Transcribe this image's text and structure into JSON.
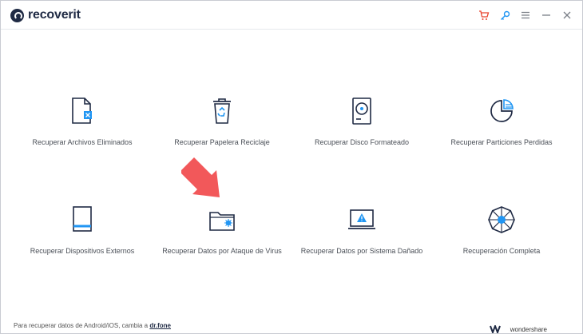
{
  "app": {
    "name_prefix": "recover",
    "name_suffix": "it"
  },
  "titlebar": {
    "icons": [
      "cart-icon",
      "key-icon",
      "menu-icon",
      "minimize-icon",
      "close-icon"
    ],
    "accent_colors": {
      "cart": "#e8432e",
      "key": "#2196f3",
      "neutral": "#7a7f87"
    }
  },
  "options": [
    {
      "label": "Recuperar Archivos Eliminados",
      "icon": "deleted-file-icon"
    },
    {
      "label": "Recuperar Papelera Reciclaje",
      "icon": "recycle-bin-icon"
    },
    {
      "label": "Recuperar Disco Formateado",
      "icon": "hard-disk-icon"
    },
    {
      "label": "Recuperar Particiones Perdidas",
      "icon": "pie-partition-icon"
    },
    {
      "label": "Recuperar Dispositivos Externos",
      "icon": "external-device-icon"
    },
    {
      "label": "Recuperar Datos por Ataque de Virus",
      "icon": "virus-folder-icon"
    },
    {
      "label": "Recuperar Datos por Sistema Dañado",
      "icon": "crashed-system-icon"
    },
    {
      "label": "Recuperación Completa",
      "icon": "all-around-icon"
    }
  ],
  "footer": {
    "text": "Para recuperar datos de Android/iOS, cambia a ",
    "link": "dr.fone"
  },
  "brand": {
    "name": "wondershare"
  },
  "colors": {
    "icon_stroke": "#1f2a44",
    "icon_accent": "#2196f3",
    "arrow": "#f2585a"
  }
}
